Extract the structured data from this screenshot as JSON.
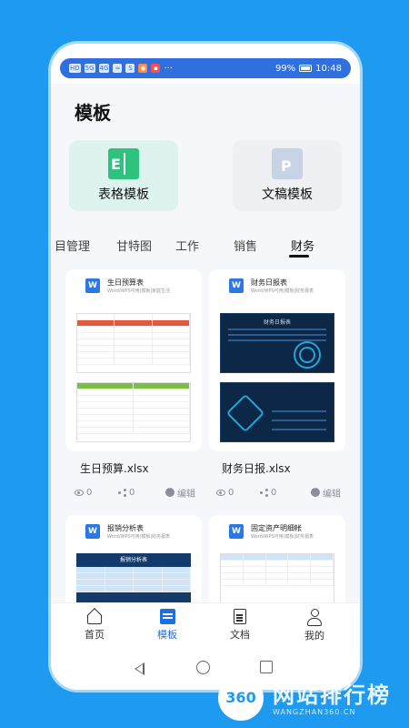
{
  "status_bar": {
    "left_icons": [
      "HD",
      "5G",
      "LTE",
      "wifi",
      "S",
      "msg",
      "app",
      "app",
      "…"
    ],
    "battery": "99%",
    "time": "10:48"
  },
  "page_title": "模板",
  "template_types": [
    {
      "label": "表格模板",
      "icon_letter": "E"
    },
    {
      "label": "文稿模板",
      "icon_letter": "P"
    }
  ],
  "tabs": [
    "目管理",
    "甘特图",
    "工作",
    "销售",
    "财务"
  ],
  "active_tab": "财务",
  "cards": [
    {
      "title": "生日预算表",
      "subtitle": "Word/WPS可用|模板|家庭生活",
      "file_name": "生日预算.xlsx",
      "views": "0",
      "shares": "0",
      "edit_label": "编辑"
    },
    {
      "title": "财务日报表",
      "subtitle": "Word/WPS可用|模板|财务报表",
      "file_name": "财务日报.xlsx",
      "views": "0",
      "shares": "0",
      "edit_label": "编辑"
    },
    {
      "title": "报销分析表",
      "subtitle": "Word/WPS可用|模板|财务报表",
      "file_name": "",
      "views": "",
      "shares": "",
      "edit_label": ""
    },
    {
      "title": "固定资产明细帐",
      "subtitle": "Word/WPS可用|模板|财务报表",
      "file_name": "",
      "views": "",
      "shares": "",
      "edit_label": ""
    }
  ],
  "preview_text": {
    "dashboard_title": "财务日报表",
    "expense_title": "报销分析表"
  },
  "bottom_nav": [
    {
      "label": "首页"
    },
    {
      "label": "模板"
    },
    {
      "label": "文档"
    },
    {
      "label": "我的"
    }
  ],
  "active_nav": "模板",
  "watermark": {
    "badge": "360",
    "text": "网站排行榜",
    "url": "WANGZHAN360.CN"
  },
  "colors": {
    "accent": "#1f6fde",
    "background": "#1e9bf0",
    "sheet_card_bg": "#dff3ee"
  }
}
